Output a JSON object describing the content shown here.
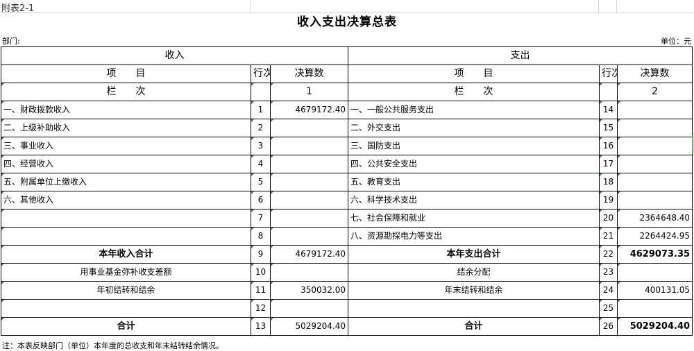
{
  "sheet": {
    "caption": "附表2-1",
    "title": "收入支出决算总表",
    "department_label": "部门:",
    "unit_label": "单位：元"
  },
  "headers": {
    "income": "收入",
    "expense": "支出",
    "item": "项　　目",
    "row_no": "行次",
    "amount": "决算数",
    "column_label": "栏　　次",
    "income_col": "1",
    "expense_col": "2"
  },
  "rows": [
    {
      "income_item": "一、财政拨款收入",
      "income_no": "1",
      "income_amount": "4679172.40",
      "expense_item": "一、一般公共服务支出",
      "expense_no": "14",
      "expense_amount": ""
    },
    {
      "income_item": "二、上级补助收入",
      "income_no": "2",
      "income_amount": "",
      "expense_item": "二、外交支出",
      "expense_no": "15",
      "expense_amount": ""
    },
    {
      "income_item": "三、事业收入",
      "income_no": "3",
      "income_amount": "",
      "expense_item": "三、国防支出",
      "expense_no": "16",
      "expense_amount": ""
    },
    {
      "income_item": "四、经营收入",
      "income_no": "4",
      "income_amount": "",
      "expense_item": "四、公共安全支出",
      "expense_no": "17",
      "expense_amount": ""
    },
    {
      "income_item": "五、附属单位上缴收入",
      "income_no": "5",
      "income_amount": "",
      "expense_item": "五、教育支出",
      "expense_no": "18",
      "expense_amount": ""
    },
    {
      "income_item": "六、其他收入",
      "income_no": "6",
      "income_amount": "",
      "expense_item": "六、科学技术支出",
      "expense_no": "19",
      "expense_amount": ""
    },
    {
      "income_item": "",
      "income_no": "7",
      "income_amount": "",
      "expense_item": "七、社会保障和就业",
      "expense_no": "20",
      "expense_amount": "2364648.40"
    },
    {
      "income_item": "",
      "income_no": "8",
      "income_amount": "",
      "expense_item": "八、资源勘探电力等支出",
      "expense_no": "21",
      "expense_amount": "2264424.95"
    },
    {
      "income_item": "本年收入合计",
      "income_no": "9",
      "income_amount": "4679172.40",
      "expense_item": "本年支出合计",
      "expense_no": "22",
      "expense_amount": "4629073.35"
    },
    {
      "income_item": "用事业基金弥补收支差额",
      "income_no": "10",
      "income_amount": "",
      "expense_item": "结余分配",
      "expense_no": "23",
      "expense_amount": ""
    },
    {
      "income_item": "年初结转和结余",
      "income_no": "11",
      "income_amount": "350032.00",
      "expense_item": "年末结转和结余",
      "expense_no": "24",
      "expense_amount": "400131.05"
    },
    {
      "income_item": "",
      "income_no": "12",
      "income_amount": "",
      "expense_item": "",
      "expense_no": "25",
      "expense_amount": ""
    },
    {
      "income_item": "合计",
      "income_no": "13",
      "income_amount": "5029204.40",
      "expense_item": "合计",
      "expense_no": "26",
      "expense_amount": "5029204.40"
    }
  ],
  "note": "注：本表反映部门（单位）本年度的总收支和年末结转结余情况。"
}
